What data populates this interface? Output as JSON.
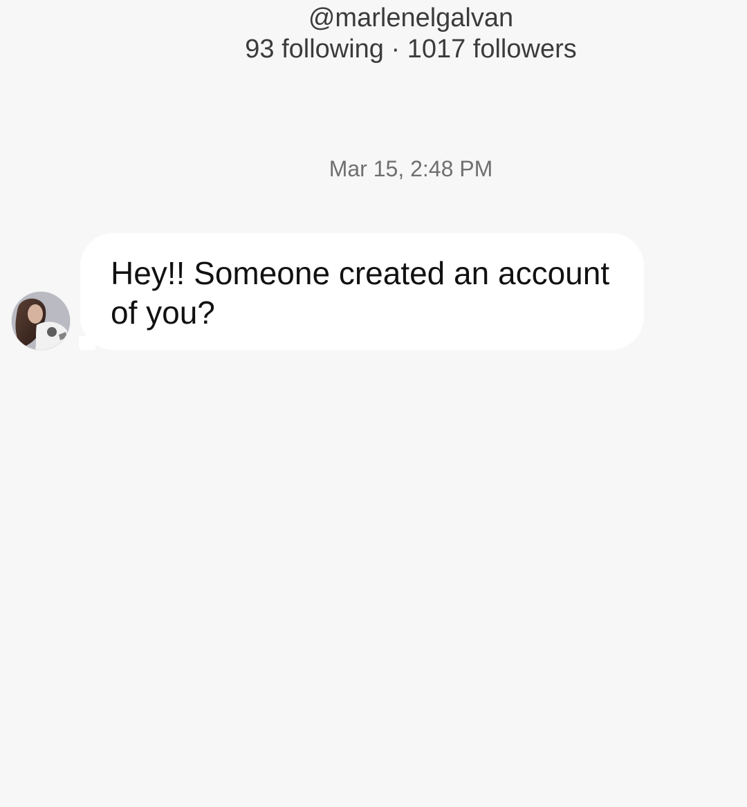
{
  "profile": {
    "username": "@marlenelgalvan",
    "stats": "93 following · 1017 followers"
  },
  "conversation": {
    "timestamp": "Mar 15, 2:48 PM",
    "messages": [
      {
        "text": "Hey!! Someone created an account of you?",
        "sender": "other"
      }
    ]
  },
  "colors": {
    "background": "#f7f7f7",
    "bubble": "#ffffff",
    "primary_text": "#111111",
    "secondary_text": "#6f6f6f"
  },
  "icons": {
    "avatar": "profile-photo"
  }
}
